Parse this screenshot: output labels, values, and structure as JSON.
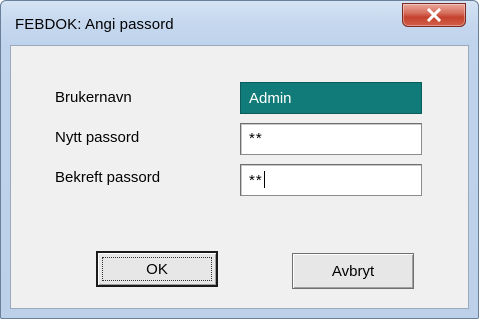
{
  "window": {
    "title": "FEBDOK: Angi passord"
  },
  "icons": {
    "close": "close-x-icon"
  },
  "form": {
    "username_label": "Brukernavn",
    "username_value": "Admin",
    "new_password_label": "Nytt passord",
    "new_password_value": "**",
    "confirm_password_label": "Bekreft passord",
    "confirm_password_value": "**"
  },
  "buttons": {
    "ok_label": "OK",
    "cancel_label": "Avbryt"
  },
  "colors": {
    "username_field_bg": "#107b78",
    "close_button": "#c4412d"
  }
}
